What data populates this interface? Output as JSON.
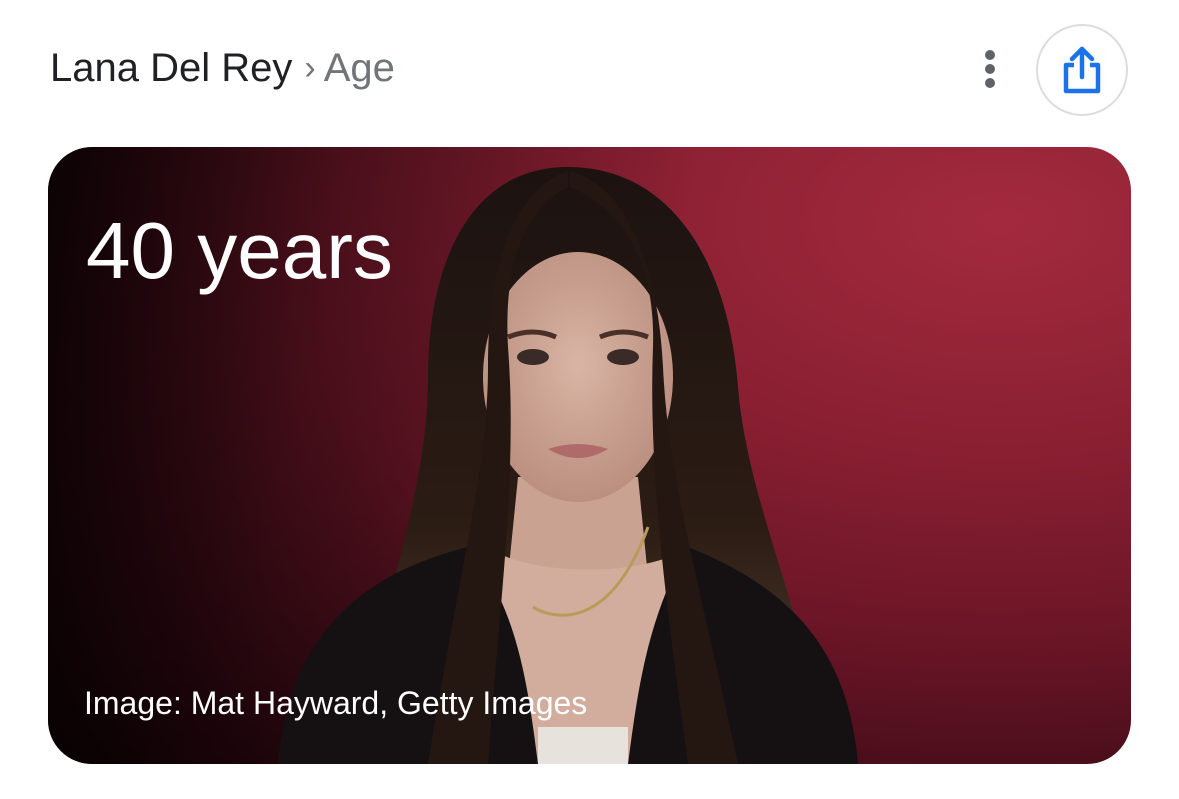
{
  "header": {
    "entity": "Lana Del Rey",
    "separator": "›",
    "attribute": "Age",
    "more_icon": "more-vertical-icon",
    "share_icon": "share-icon"
  },
  "card": {
    "age_value": "40 years",
    "image_credit": "Image: Mat Hayward, Getty Images"
  },
  "colors": {
    "text_primary": "#202124",
    "text_secondary": "#70757a",
    "accent_blue": "#1a73e8",
    "background_red": "#8a1f32"
  }
}
